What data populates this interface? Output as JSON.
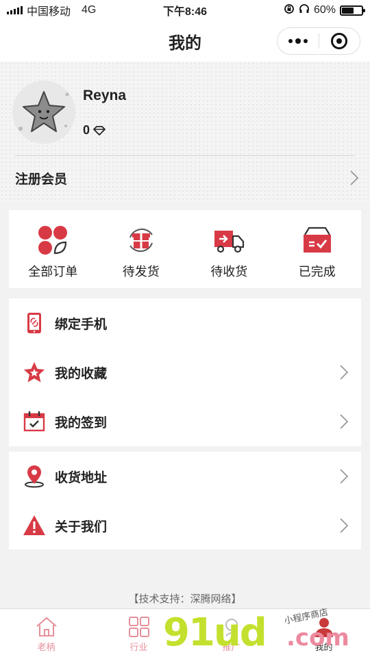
{
  "status_bar": {
    "carrier": "中国移动",
    "network": "4G",
    "time": "下午8:46",
    "battery_percent": "60%",
    "battery_level": 0.6
  },
  "nav": {
    "title": "我的",
    "more_icon": "more-dots-icon",
    "close_icon": "target-circle-icon"
  },
  "profile": {
    "username": "Reyna",
    "points": "0",
    "points_icon": "diamond-icon",
    "avatar_icon": "starfish-avatar",
    "register_label": "注册会员"
  },
  "orders": [
    {
      "label": "全部订单",
      "icon": "all-orders-icon"
    },
    {
      "label": "待发货",
      "icon": "gift-pending-icon"
    },
    {
      "label": "待收货",
      "icon": "truck-icon"
    },
    {
      "label": "已完成",
      "icon": "box-completed-icon"
    }
  ],
  "menu_group_1": [
    {
      "label": "绑定手机",
      "icon": "phone-link-icon"
    },
    {
      "label": "我的收藏",
      "icon": "star-icon"
    },
    {
      "label": "我的签到",
      "icon": "calendar-check-icon"
    }
  ],
  "menu_group_2": [
    {
      "label": "收货地址",
      "icon": "location-pin-icon"
    },
    {
      "label": "关于我们",
      "icon": "warning-icon"
    }
  ],
  "footer": {
    "support": "【技术支持：深腾网络】"
  },
  "tabbar": [
    {
      "label": "老柄",
      "icon": "home-icon"
    },
    {
      "label": "行业",
      "icon": "grid-icon"
    },
    {
      "label": "推广",
      "icon": "promote-icon"
    },
    {
      "label": "我的",
      "icon": "user-icon"
    }
  ],
  "watermark": {
    "big": "91ud",
    "com": ".com",
    "small": "小程序商店"
  },
  "colors": {
    "accent": "#d83a45",
    "text": "#222222",
    "background": "#f2f2f2",
    "tab_inactive": "#e58f99"
  }
}
